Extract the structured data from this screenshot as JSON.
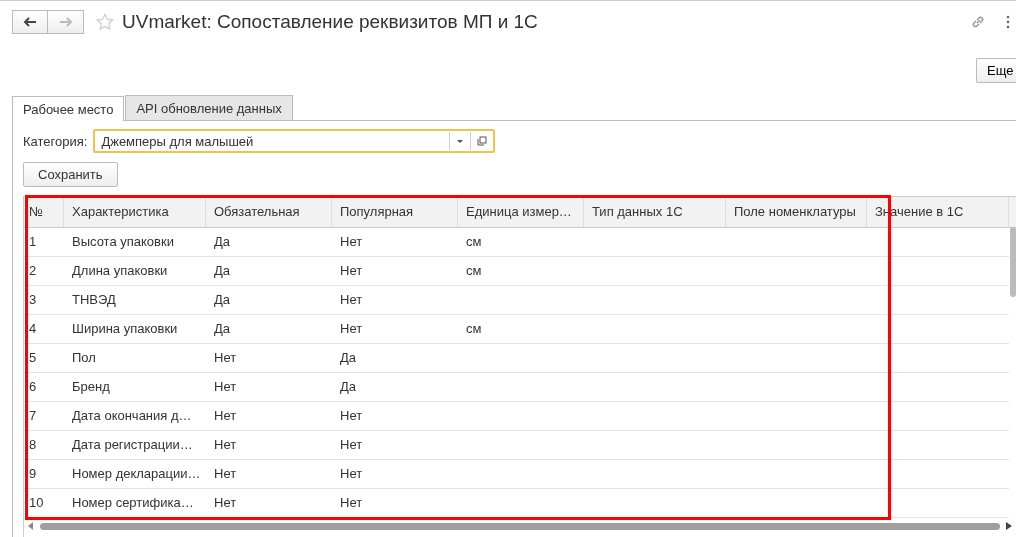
{
  "window": {
    "title": "UVmarket: Сопоставление реквизитов МП и 1С"
  },
  "more_button": "Еще",
  "tabs": [
    {
      "label": "Рабочее место",
      "selected": true
    },
    {
      "label": "API обновление данных",
      "selected": false
    }
  ],
  "category": {
    "label": "Категория:",
    "value": "Джемперы для малышей"
  },
  "save_button": "Сохранить",
  "table": {
    "columns": [
      "№",
      "Характеристика",
      "Обязательная",
      "Популярная",
      "Единица измер…",
      "Тип данных 1С",
      "Поле номенклатуры",
      "Значение в 1С"
    ],
    "rows": [
      {
        "no": "1",
        "name": "Высота упаковки",
        "required": "Да",
        "popular": "Нет",
        "unit": "см"
      },
      {
        "no": "2",
        "name": "Длина упаковки",
        "required": "Да",
        "popular": "Нет",
        "unit": "см"
      },
      {
        "no": "3",
        "name": "ТНВЭД",
        "required": "Да",
        "popular": "Нет"
      },
      {
        "no": "4",
        "name": "Ширина упаковки",
        "required": "Да",
        "popular": "Нет",
        "unit": "см"
      },
      {
        "no": "5",
        "name": "Пол",
        "required": "Нет",
        "popular": "Да"
      },
      {
        "no": "6",
        "name": "Бренд",
        "required": "Нет",
        "popular": "Да"
      },
      {
        "no": "7",
        "name": "Дата окончания д…",
        "required": "Нет",
        "popular": "Нет"
      },
      {
        "no": "8",
        "name": "Дата регистрации…",
        "required": "Нет",
        "popular": "Нет"
      },
      {
        "no": "9",
        "name": "Номер декларации…",
        "required": "Нет",
        "popular": "Нет"
      },
      {
        "no": "10",
        "name": "Номер сертифика…",
        "required": "Нет",
        "popular": "Нет"
      }
    ]
  }
}
